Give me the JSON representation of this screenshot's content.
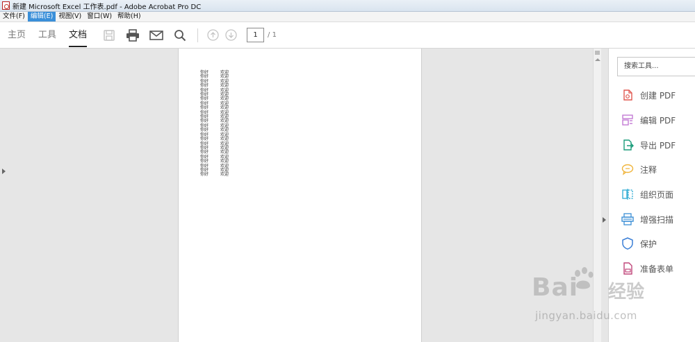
{
  "window": {
    "title": "新建 Microsoft Excel 工作表.pdf - Adobe Acrobat Pro DC"
  },
  "menubar": {
    "items": [
      "文件(F)",
      "编辑(E)",
      "视图(V)",
      "窗口(W)",
      "帮助(H)"
    ],
    "active_index": 1
  },
  "toolbar": {
    "tabs": [
      "主页",
      "工具",
      "文档"
    ],
    "active_tab": "文档",
    "page_number": "1",
    "page_total": "/ 1",
    "icons": [
      "save-icon",
      "print-icon",
      "mail-icon",
      "search-icon",
      "prev-page-icon",
      "next-page-icon"
    ]
  },
  "document": {
    "col1": "你好",
    "col2": "欢迎",
    "row_count": 24
  },
  "tools_pane": {
    "search_placeholder": "搜索工具...",
    "tools": [
      {
        "label": "创建 PDF",
        "icon": "create-pdf-icon",
        "color": "#e0574f"
      },
      {
        "label": "编辑 PDF",
        "icon": "edit-pdf-icon",
        "color": "#c37ad4"
      },
      {
        "label": "导出 PDF",
        "icon": "export-pdf-icon",
        "color": "#1a9c7a"
      },
      {
        "label": "注释",
        "icon": "comment-icon",
        "color": "#f0b43a"
      },
      {
        "label": "组织页面",
        "icon": "organize-pages-icon",
        "color": "#3bb0d6"
      },
      {
        "label": "增强扫描",
        "icon": "enhance-scan-icon",
        "color": "#3b8fd6"
      },
      {
        "label": "保护",
        "icon": "protect-icon",
        "color": "#3b7fd6"
      },
      {
        "label": "准备表单",
        "icon": "prepare-form-icon",
        "color": "#c0467a"
      }
    ]
  },
  "watermark": {
    "brand": "Bai",
    "brand_suffix": "经验",
    "url": "jingyan.baidu.com"
  }
}
